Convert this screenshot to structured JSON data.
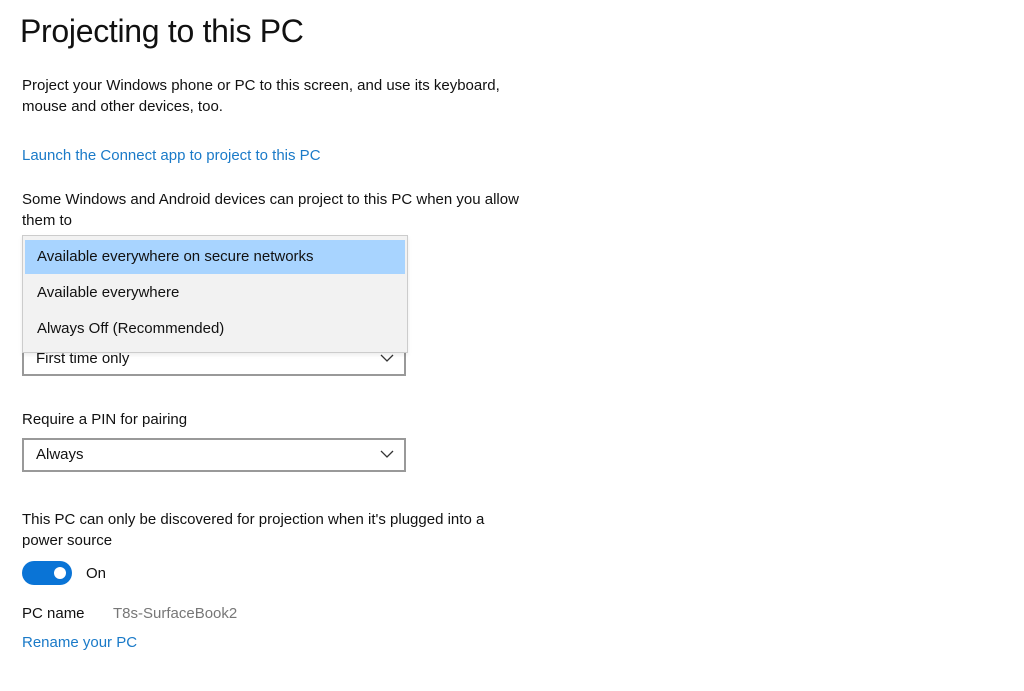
{
  "header": {
    "title": "Projecting to this PC"
  },
  "intro": {
    "description": "Project your Windows phone or PC to this screen, and use its keyboard, mouse and other devices, too.",
    "connect_link": "Launch the Connect app to project to this PC"
  },
  "availability": {
    "label": "Some Windows and Android devices can project to this PC when you allow them to",
    "options": [
      {
        "label": "Available everywhere on secure networks",
        "selected": true
      },
      {
        "label": "Available everywhere",
        "selected": false
      },
      {
        "label": "Always Off (Recommended)",
        "selected": false
      }
    ],
    "highlight_color": "#a8d4ff"
  },
  "ask_to_project": {
    "value": "First time only"
  },
  "pin": {
    "label": "Require a PIN for pairing",
    "value": "Always"
  },
  "power": {
    "label": "This PC can only be discovered for projection when it's plugged into a power source",
    "toggle_state": "On",
    "toggle_on": true,
    "accent_color": "#0a74d6"
  },
  "pc_name": {
    "label": "PC name",
    "value": "T8s-SurfaceBook2",
    "rename_link": "Rename your PC"
  },
  "icons": {
    "chevron": "chevron-down-icon"
  }
}
